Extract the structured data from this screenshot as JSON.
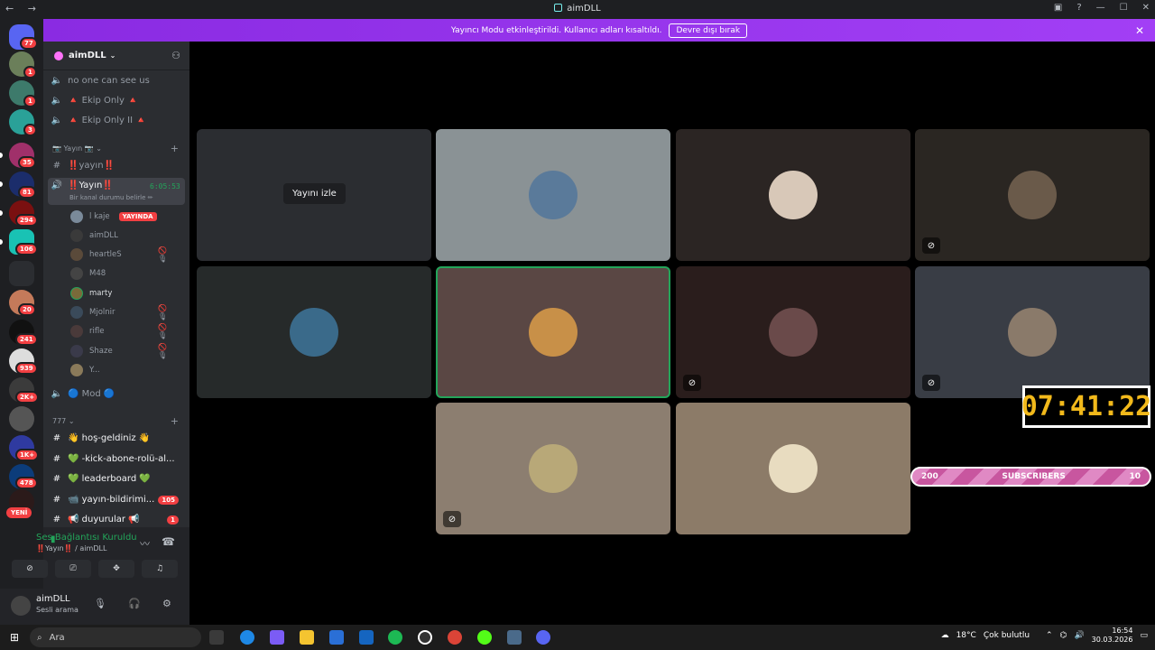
{
  "window": {
    "title": "aimDLL"
  },
  "banner": {
    "text": "Yayıncı Modu etkinleştirildi. Kullanıcı adları kısaltıldı.",
    "button": "Devre dışı bırak"
  },
  "rail": {
    "badges": [
      "77",
      "1",
      "1",
      "3",
      "35",
      "81",
      "294",
      "106",
      "20",
      "241",
      "939",
      "2K+",
      "1K+",
      "478"
    ],
    "new_label": "YENİ"
  },
  "server": {
    "name": "aimDLL"
  },
  "channels": {
    "top": [
      "no one can see us",
      "🔺 Ekip Only 🔺",
      "🔺 Ekip Only II 🔺"
    ],
    "category_stream": "📷 Yayın 📷",
    "text_stream": "‼️yayın‼️",
    "voice_stream": "‼️Yayın‼️",
    "voice_status": "Bir kanal durumu belirle ✏",
    "voice_timer": "6:05:53",
    "users": [
      {
        "name": "l kaje",
        "live": "YAYINDA"
      },
      {
        "name": "aimDLL"
      },
      {
        "name": "heartleS"
      },
      {
        "name": "M48"
      },
      {
        "name": "marty"
      },
      {
        "name": "Mjolnir"
      },
      {
        "name": "rifle"
      },
      {
        "name": "Shaze"
      },
      {
        "name": "Y..."
      }
    ],
    "mod": "🔵 Mod 🔵",
    "category_777": "777",
    "list777": [
      {
        "name": "👋 hoş-geldiniz 👋"
      },
      {
        "name": "💚 -kick-abone-rolü-al..."
      },
      {
        "name": "💚 leaderboard 💚"
      },
      {
        "name": "📹 yayın-bildirimi...",
        "count": "105"
      },
      {
        "name": "📢 duyurular 📢",
        "count": "1"
      }
    ]
  },
  "voice": {
    "status": "Ses Bağlantısı Kuruldu",
    "sub": "‼️Yayın‼️ / aimDLL"
  },
  "me": {
    "name": "aimDLL",
    "status": "Sesli arama"
  },
  "stage": {
    "watch_label": "Yayını izle"
  },
  "overlay": {
    "timer": "07:41:22",
    "subs_left": "200",
    "subs_label": "SUBSCRIBERS",
    "subs_right": "10"
  },
  "taskbar": {
    "search": "Ara",
    "weather": "18°C",
    "weather_desc": "Çok bulutlu",
    "time": "16:54",
    "date": "30.03.2026"
  }
}
